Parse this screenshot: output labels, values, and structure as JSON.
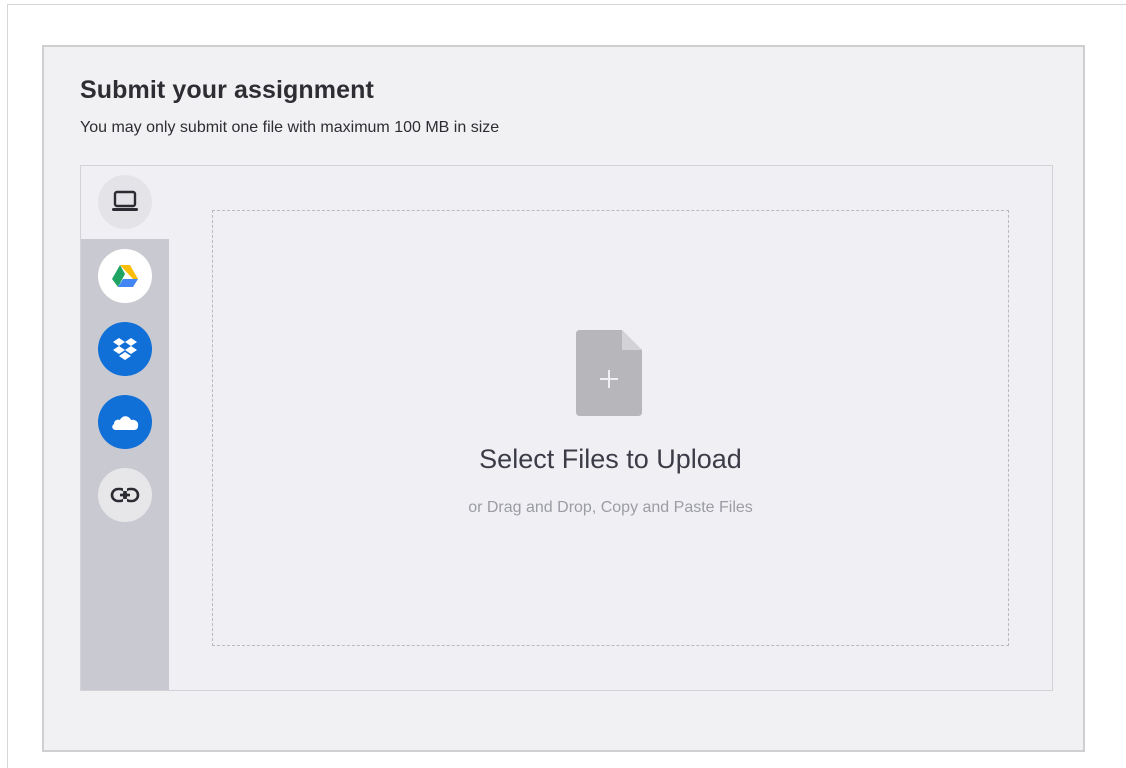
{
  "header": {
    "title": "Submit your assignment",
    "subtitle": "You may only submit one file with maximum 100 MB in size"
  },
  "sources": [
    {
      "name": "My Device",
      "icon": "laptop-icon",
      "selected": true
    },
    {
      "name": "Google Drive",
      "icon": "google-drive-icon",
      "selected": false
    },
    {
      "name": "Dropbox",
      "icon": "dropbox-icon",
      "selected": false
    },
    {
      "name": "OneDrive",
      "icon": "onedrive-icon",
      "selected": false
    },
    {
      "name": "Link",
      "icon": "link-icon",
      "selected": false
    }
  ],
  "dropzone": {
    "title": "Select Files to Upload",
    "subtitle": "or Drag and Drop, Copy and Paste Files",
    "icon": "add-file-icon"
  },
  "colors": {
    "panel_bg": "#f1f1f3",
    "sidebar_bg": "#c9c9d1",
    "accent_blue": "#1170d8",
    "file_icon": "#b7b7bb"
  }
}
